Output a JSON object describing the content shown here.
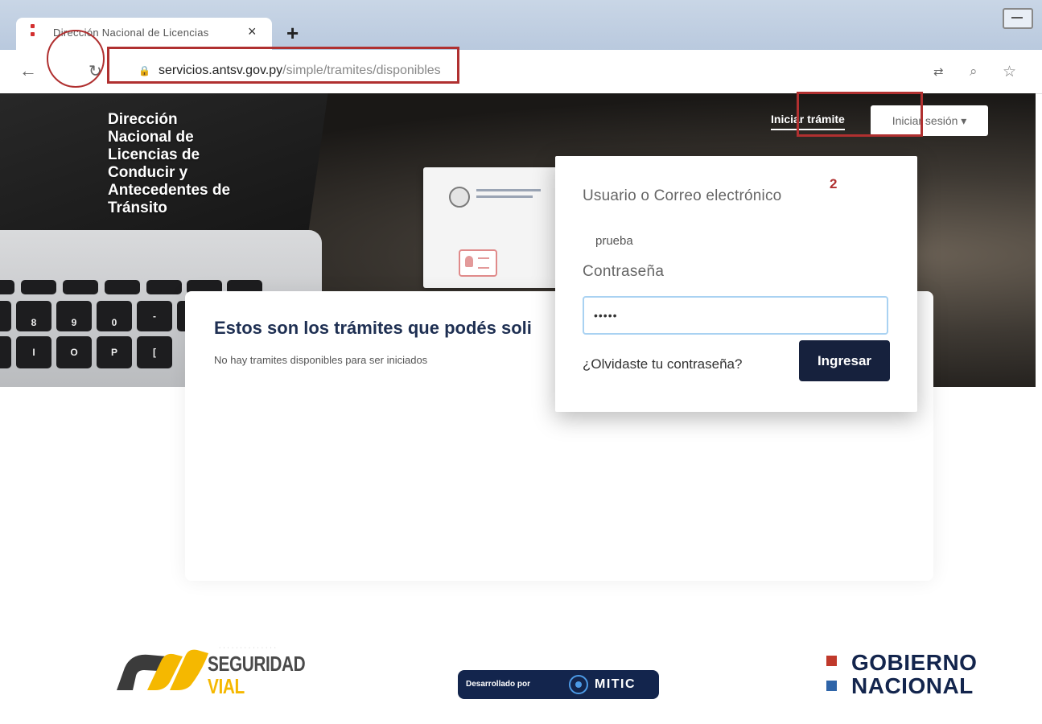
{
  "browser": {
    "tab_title": "Dirección Nacional de Licencias",
    "url_host": "servicios.antsv.gov.py",
    "url_path": "/simple/tramites/disponibles",
    "icons": {
      "back": "←",
      "reload": "↻",
      "lock": "🔒",
      "translate": "⇄",
      "zoom": "⌕",
      "star": "☆",
      "close": "×",
      "new_tab": "+"
    }
  },
  "site": {
    "name": "Dirección\nNacional de\nLicencias de\nConducir y\nAntecedentes de\nTránsito"
  },
  "nav": {
    "iniciar_tramite": "Iniciar trámite",
    "iniciar_sesion": "Iniciar sesión ▾"
  },
  "login": {
    "step_marker": "2",
    "user_label": "Usuario o Correo electrónico",
    "user_value": "prueba",
    "password_label": "Contraseña",
    "password_value": "•••••",
    "forgot_link": "¿Olvidaste tu contraseña?",
    "submit": "Ingresar"
  },
  "content": {
    "title": "Estos son los trámites que podés soli",
    "empty_message": "No hay tramites disponibles para ser iniciados"
  },
  "keyboard": {
    "row1": [
      "",
      "",
      "",
      "",
      "",
      "",
      ""
    ],
    "row2": [
      "8",
      "9",
      "0",
      "-",
      ""
    ],
    "row3": [
      "I",
      "O",
      "P",
      "["
    ]
  },
  "footer": {
    "sv_word1": "SEGURIDAD",
    "sv_word2": "VIAL",
    "mitic_prefix": "Desarrollado por",
    "mitic_name": "MITIC",
    "gob_line1": "GOBIERNO",
    "gob_line2": "NACIONAL"
  },
  "colors": {
    "annotation_red": "#b03030",
    "brand_navy": "#16213d",
    "sv_yellow": "#f5b800",
    "gob_red": "#c0392b",
    "gob_blue": "#2e64a8"
  }
}
